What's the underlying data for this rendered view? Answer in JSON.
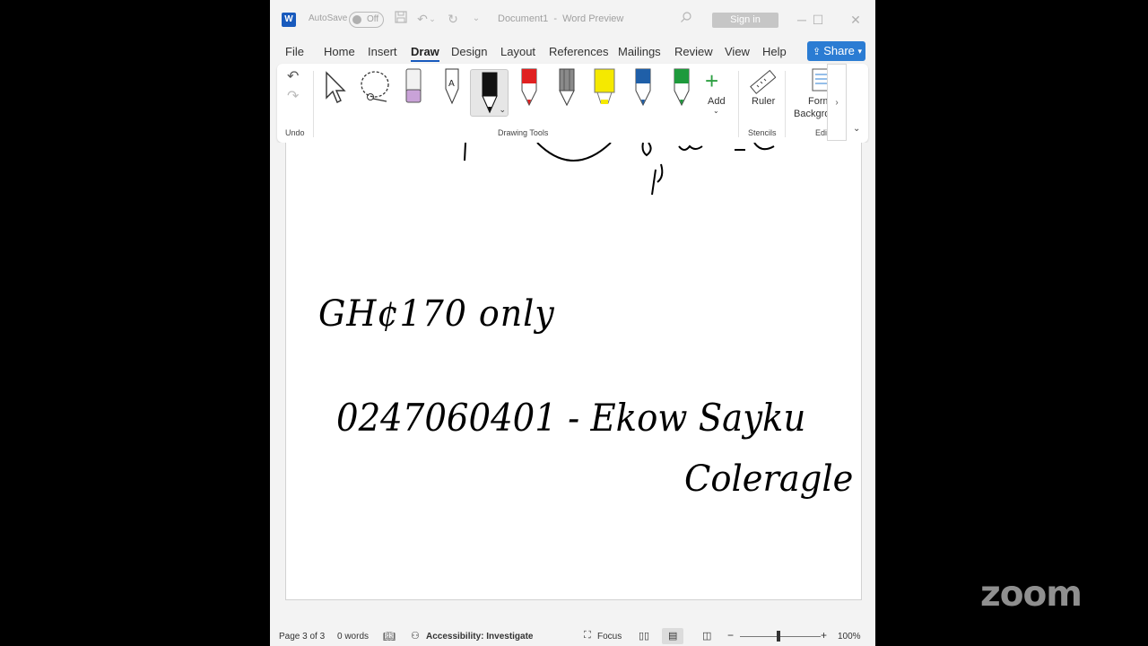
{
  "title_bar": {
    "autosave_label": "AutoSave",
    "autosave_state": "Off",
    "document_title": "Document1",
    "separator": "-",
    "app_name": "Word Preview",
    "sign_in": "Sign in"
  },
  "menu": {
    "tabs": [
      "File",
      "Home",
      "Insert",
      "Draw",
      "Design",
      "Layout",
      "References",
      "Mailings",
      "Review",
      "View",
      "Help"
    ],
    "active_tab": "Draw",
    "share": "Share"
  },
  "ribbon": {
    "groups": {
      "undo": "Undo",
      "drawing_tools": "Drawing Tools",
      "stencils": "Stencils",
      "editing": "Edi"
    },
    "add_label": "Add",
    "ruler_label": "Ruler",
    "format_label_line1": "Form",
    "format_label_line2": "Backgro",
    "pens": [
      {
        "name": "pencil-black",
        "color": "#1a1a1a"
      },
      {
        "name": "pen-red",
        "color": "#e02020"
      },
      {
        "name": "pencil-gray",
        "color": "#707070"
      },
      {
        "name": "highlighter-yellow",
        "color": "#f5e900"
      },
      {
        "name": "pen-blue",
        "color": "#1f5fa8"
      },
      {
        "name": "pen-green",
        "color": "#1e9a3c"
      }
    ]
  },
  "document": {
    "handwriting": {
      "line1": "GH¢170 only",
      "line2": "0247060401 - Ekow Sayku",
      "line3": "Coleragle"
    }
  },
  "status_bar": {
    "page": "Page 3 of 3",
    "words": "0 words",
    "accessibility": "Accessibility: Investigate",
    "focus": "Focus",
    "zoom": "100%"
  },
  "overlay": {
    "zoom_logo": "zoom"
  }
}
